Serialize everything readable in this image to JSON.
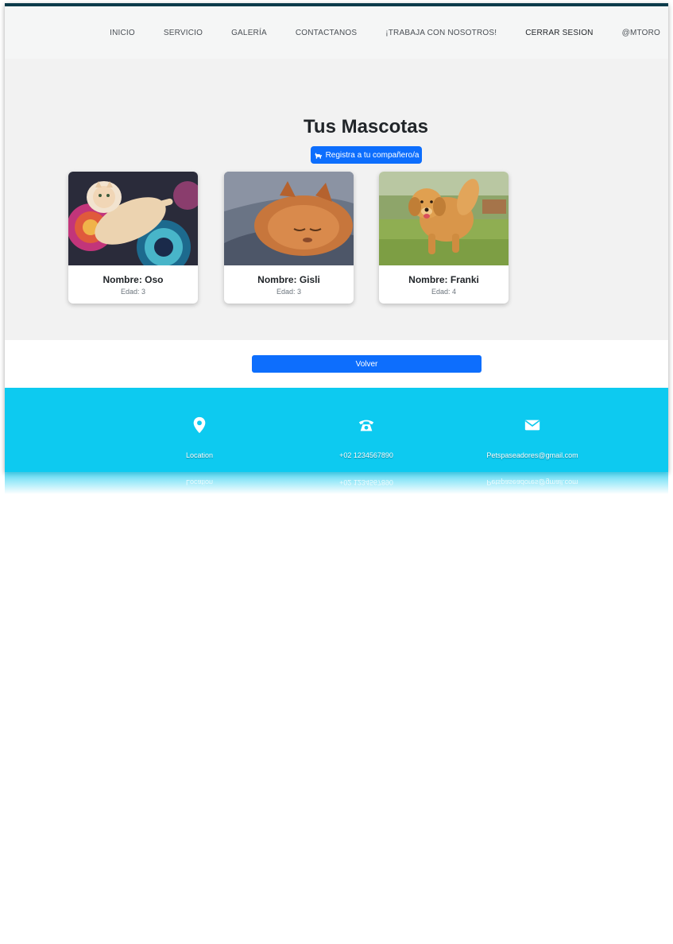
{
  "nav": {
    "items": [
      {
        "label": "INICIO"
      },
      {
        "label": "SERVICIO"
      },
      {
        "label": "GALERÍA"
      },
      {
        "label": "CONTACTANOS"
      },
      {
        "label": "¡TRABAJA CON NOSOTROS!"
      },
      {
        "label": "CERRAR SESION"
      },
      {
        "label": "@MTORO"
      }
    ]
  },
  "main": {
    "title": "Tus Mascotas",
    "register_button": "Registra a tu compañero/a",
    "register_icon": "dog-icon",
    "pets": [
      {
        "name": "Nombre: Oso",
        "age": "Edad: 3"
      },
      {
        "name": "Nombre: Gisli",
        "age": "Edad: 3"
      },
      {
        "name": "Nombre: Franki",
        "age": "Edad: 4"
      }
    ],
    "back_button": "Volver"
  },
  "footer": {
    "location": {
      "icon": "location-pin-icon",
      "text": "Location"
    },
    "phone": {
      "icon": "phone-icon",
      "text": "+02 1234567890"
    },
    "email": {
      "icon": "envelope-icon",
      "text": "Petspaseadores@gmail.com"
    }
  },
  "colors": {
    "primary": "#0d6efd",
    "footer": "#0dcaf0",
    "topbar": "#0b3b4b"
  }
}
